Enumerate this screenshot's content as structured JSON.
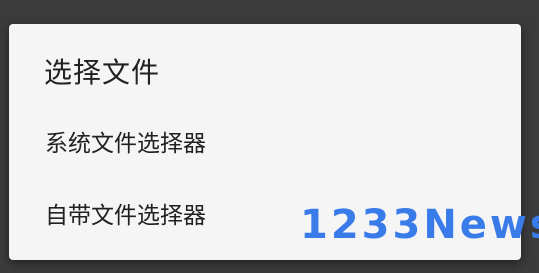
{
  "dialog": {
    "title": "选择文件",
    "options": [
      {
        "label": "系统文件选择器"
      },
      {
        "label": "自带文件选择器"
      }
    ]
  },
  "watermark": {
    "text": "1233News"
  },
  "colors": {
    "backdrop": "#3b3b3b",
    "dialog_bg": "#f5f5f5",
    "text": "#212121",
    "watermark": "#3a7bea"
  }
}
